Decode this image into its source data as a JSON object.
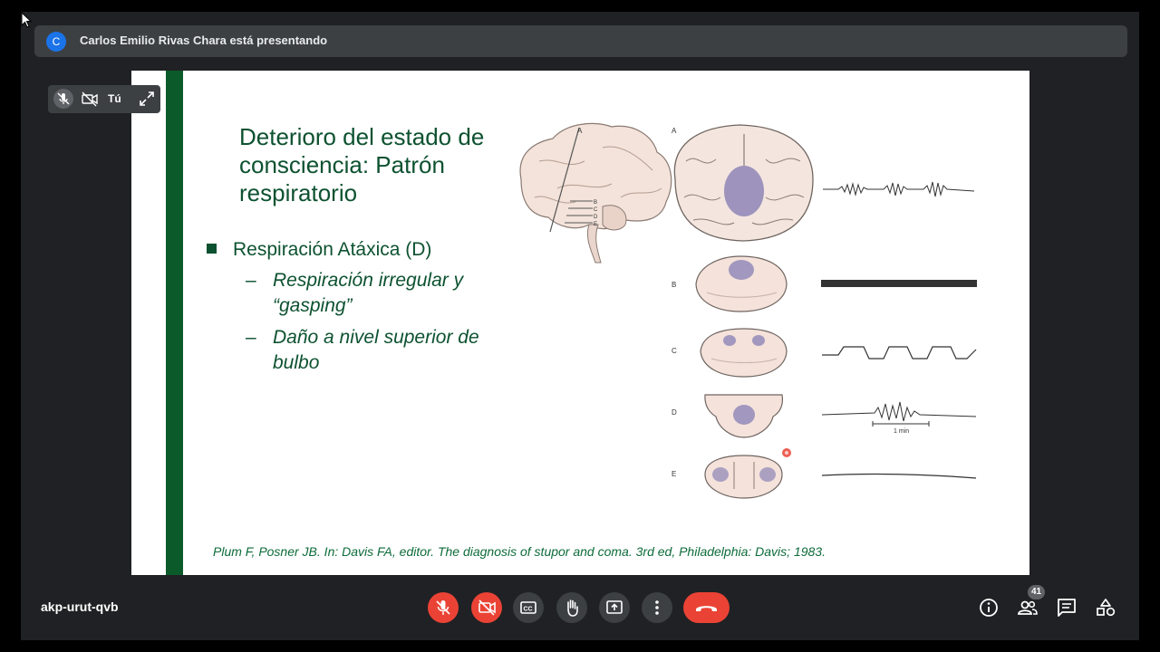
{
  "presenter": {
    "initial": "C",
    "text": "Carlos Emilio Rivas Chara está presentando"
  },
  "self_tile": {
    "label": "Tú",
    "icons": [
      "mic-off-icon",
      "camera-off-icon",
      "expand-icon"
    ]
  },
  "slide": {
    "title": "Deterioro del estado de consciencia: Patrón respiratorio",
    "bullet": "Respiración Atáxica (D)",
    "sub_items": [
      {
        "dash": "–",
        "text": "Respiración irregular y “gasping”"
      },
      {
        "dash": "–",
        "text": "Daño a nivel superior de bulbo"
      }
    ],
    "citation": "Plum F, Posner JB. In: Davis FA, editor. The diagnosis of stupor and coma. 3rd ed, Philadelphia: Davis; 1983.",
    "figure": {
      "brain_label": "A",
      "level_labels": [
        "B",
        "C",
        "D",
        "E"
      ],
      "rows": [
        "A",
        "B",
        "C",
        "D",
        "E"
      ],
      "scale_label": "1 min"
    }
  },
  "meeting": {
    "code": "akp-urut-qvb",
    "participants_count": "41"
  },
  "controls": {
    "center": [
      "mic-off-icon",
      "camera-off-icon",
      "captions-icon",
      "raise-hand-icon",
      "present-icon",
      "more-options-icon",
      "hang-up-icon"
    ],
    "right": [
      "info-icon",
      "people-icon",
      "chat-icon",
      "activities-icon"
    ]
  },
  "colors": {
    "slide_accent": "#0b5a2a",
    "slide_text": "#0d5230",
    "danger": "#ea4335",
    "control_bg": "#3c4043"
  }
}
